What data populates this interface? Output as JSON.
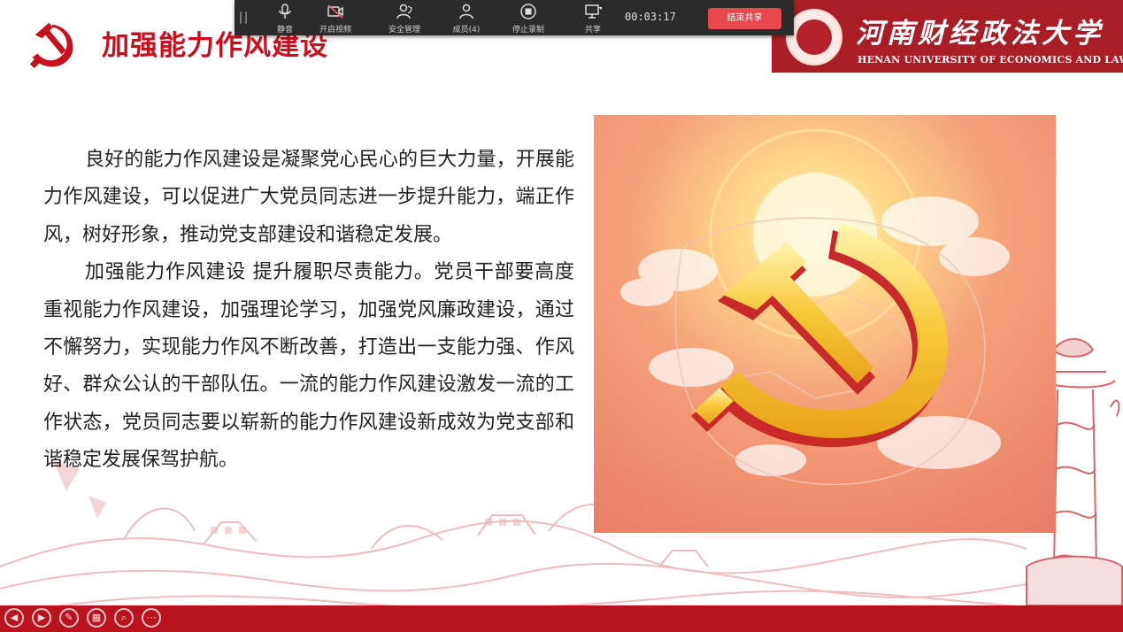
{
  "slide": {
    "title": "加强能力作风建设",
    "paragraphs": [
      "良好的能力作风建设是凝聚党心民心的巨大力量，开展能力作风建设，可以促进广大党员同志进一步提升能力，端正作风，树好形象，推动党支部建设和谐稳定发展。",
      "加强能力作风建设  提升履职尽责能力。党员干部要高度重视能力作风建设，加强理论学习，加强党风廉政建设，通过不懈努力，实现能力作风不断改善，打造出一支能力强、作风好、群众公认的干部队伍。一流的能力作风建设激发一流的工作状态，党员同志要以崭新的能力作风建设新成效为党支部和谐稳定发展保驾护航。"
    ]
  },
  "university": {
    "name_cn": "河南财经政法大学",
    "name_en": "HENAN UNIVERSITY OF ECONOMICS AND LAW"
  },
  "toolbar": {
    "items": [
      {
        "label": "静音",
        "icon": "microphone-icon"
      },
      {
        "label": "开启视频",
        "icon": "camera-off-icon"
      },
      {
        "label": "安全管理",
        "icon": "shield-user-icon"
      },
      {
        "label": "成员(4)",
        "icon": "members-icon"
      },
      {
        "label": "停止录制",
        "icon": "record-icon"
      },
      {
        "label": "共享",
        "icon": "share-screen-icon"
      }
    ],
    "timer": "00:03:17",
    "stop_share_label": "结束共享"
  },
  "nav": [
    {
      "icon": "previous-icon"
    },
    {
      "icon": "next-icon"
    },
    {
      "icon": "pen-icon"
    },
    {
      "icon": "slides-icon"
    },
    {
      "icon": "zoom-icon"
    },
    {
      "icon": "more-icon"
    }
  ],
  "colors": {
    "brand_red": "#c8101d",
    "banner_red": "#a91d24",
    "bar_red": "#b9141e",
    "gold": "#f5c518"
  }
}
